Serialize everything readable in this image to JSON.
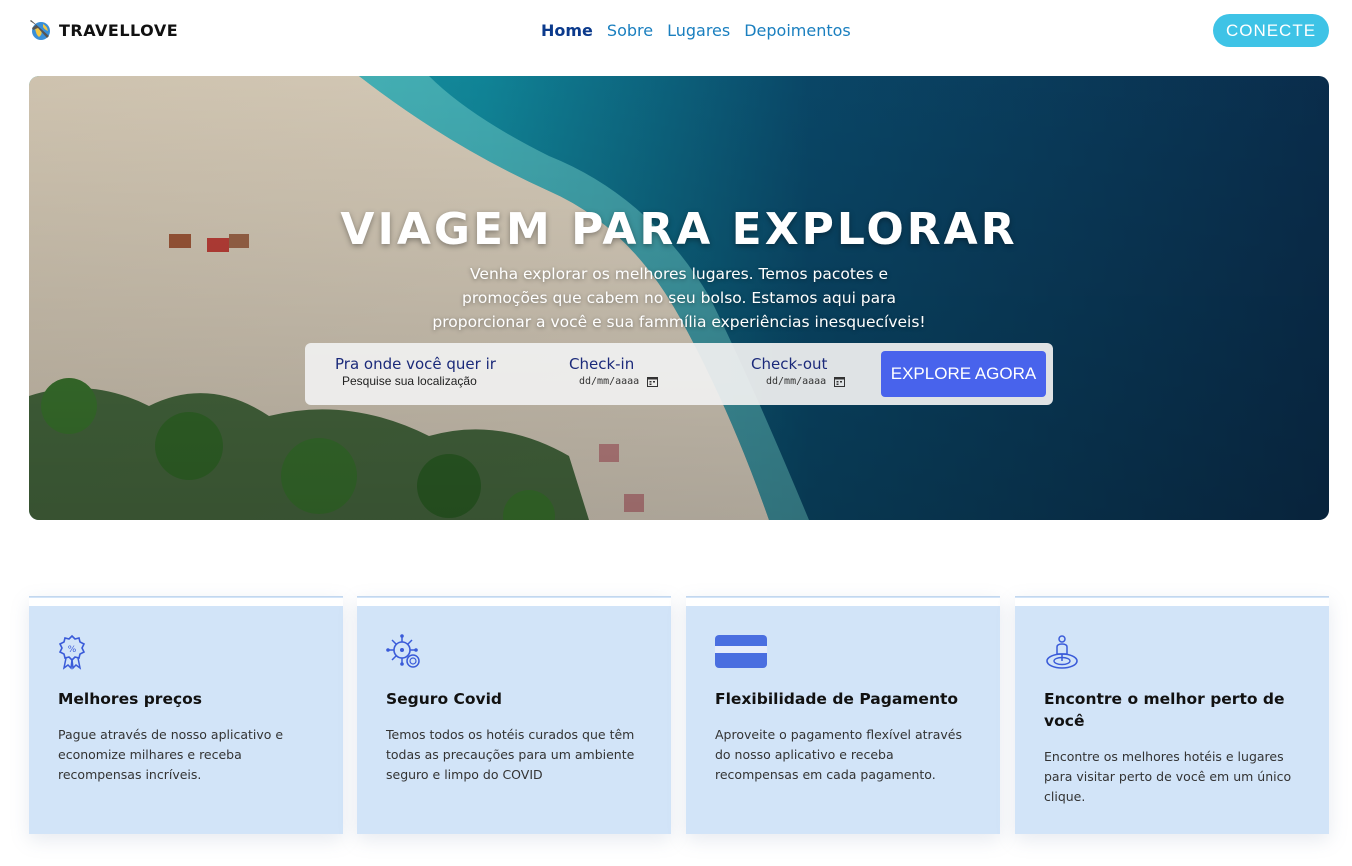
{
  "brand": {
    "name": "TRAVELLOVE",
    "logo_icon": "airplane-globe-icon"
  },
  "nav": {
    "links": [
      {
        "label": "Home",
        "active": true
      },
      {
        "label": "Sobre",
        "active": false
      },
      {
        "label": "Lugares",
        "active": false
      },
      {
        "label": "Depoimentos",
        "active": false
      }
    ],
    "connect_label": "CONECTE"
  },
  "hero": {
    "title": "VIAGEM PARA EXPLORAR",
    "subtitle": "Venha explorar os melhores lugares. Temos pacotes e promoções que cabem no seu bolso. Estamos aqui para proporcionar a você e sua fammília experiências inesquecíveis!"
  },
  "search": {
    "destination_label": "Pra onde você quer ir",
    "destination_placeholder": "Pesquise sua localização",
    "checkin_label": "Check-in",
    "checkin_value": "dd/mm/aaaa",
    "checkout_label": "Check-out",
    "checkout_value": "dd/mm/aaaa",
    "explore_label": "EXPLORE AGORA"
  },
  "features": [
    {
      "icon": "discount-badge-icon",
      "title": "Melhores preços",
      "text": "Pague através de nosso aplicativo e economize milhares e receba recompensas incríveis."
    },
    {
      "icon": "virus-shield-icon",
      "title": "Seguro Covid",
      "text": "Temos todos os hotéis curados que têm todas as precauções para um ambiente seguro e limpo do COVID"
    },
    {
      "icon": "credit-card-icon",
      "title": "Flexibilidade de Pagamento",
      "text": "Aproveite o pagamento flexível através do nosso aplicativo e receba recompensas em cada pagamento."
    },
    {
      "icon": "location-person-icon",
      "title": "Encontre o melhor perto de você",
      "text": "Encontre os melhores hotéis e lugares para visitar perto de você em um único clique."
    }
  ],
  "colors": {
    "accent": "#4863ec",
    "connect": "#3ec3e6",
    "card_bg": "#d2e4f8",
    "nav_link": "#1a7fbf",
    "nav_active": "#0b3a8c"
  }
}
